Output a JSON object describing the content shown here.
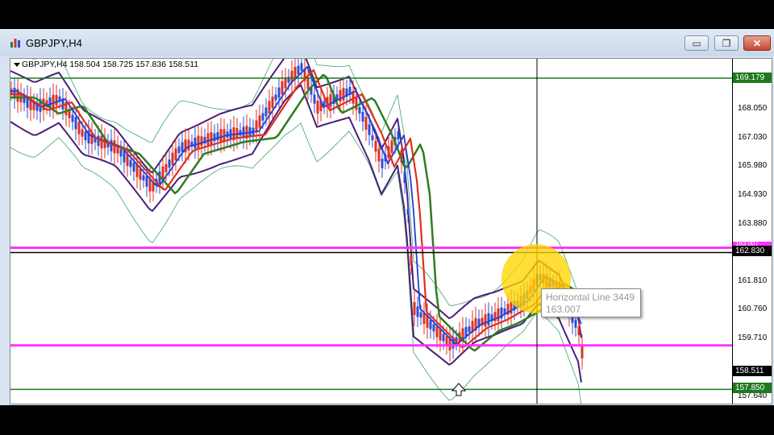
{
  "window": {
    "title": "GBPJPY,H4",
    "buttons": {
      "minimize": "▭",
      "restore": "❐",
      "close": "✕"
    }
  },
  "chart": {
    "symbol_line": "GBPJPY,H4  158.504 158.725 157.836 158.511",
    "price_ticks": [
      "168.050",
      "167.030",
      "165.980",
      "164.930",
      "163.880",
      "161.810",
      "160.760",
      "159.710",
      "157.640"
    ],
    "tags": [
      {
        "label": "169.179",
        "color": "#1d7a1d"
      },
      {
        "label": "162.830",
        "color": "#000000"
      },
      {
        "label": "158.511",
        "color": "#000000"
      },
      {
        "label": "157.850",
        "color": "#1d7a1d"
      }
    ],
    "hidden_tag": "163.007",
    "horizontal_lines": [
      {
        "price": 169.179,
        "color": "#1d7a1d"
      },
      {
        "price": 163.007,
        "color": "#ff33ff"
      },
      {
        "price": 162.83,
        "color": "#000000"
      },
      {
        "price": 159.45,
        "color": "#ff33ff"
      },
      {
        "price": 157.85,
        "color": "#1d7a1d"
      }
    ],
    "tooltip": {
      "name": "Horizontal Line 3449",
      "value": "163.007"
    },
    "colors": {
      "ma_fast": "#1f3fd6",
      "ma_mid": "#e0301e",
      "ma_slow": "#2f7d20",
      "bands_outer": "#4a1e7a",
      "bands_inner": "#3aa66a",
      "bull": "#2c4ed6",
      "bear": "#e0301e"
    }
  }
}
